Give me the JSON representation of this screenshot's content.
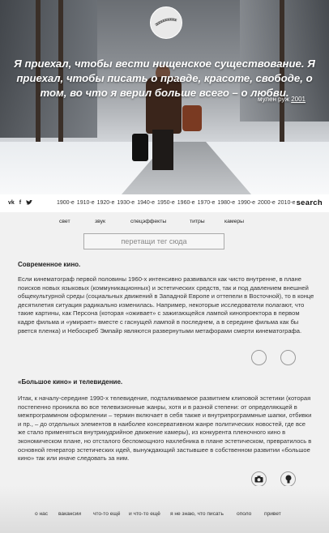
{
  "hero": {
    "quote": "Я приехал, чтобы вести нищенское существование. Я приехал, чтобы писать о правде, красоте, свободе, о том, во что я верил больше всего – о любви.",
    "source_title": "мулен руж",
    "source_year": "2001"
  },
  "nav": {
    "social": [
      "vk",
      "f",
      "t"
    ],
    "decades": [
      "1900-е",
      "1910-е",
      "1920-е",
      "1930-е",
      "1940-е",
      "1950-е",
      "1960-е",
      "1970-е",
      "1980-е",
      "1990-е",
      "2000-е",
      "2010-е"
    ],
    "search_label": "search"
  },
  "tags": [
    "свет",
    "звук",
    "спецэффекты",
    "титры",
    "камеры"
  ],
  "dropzone": {
    "placeholder": "перетащи тег сюда"
  },
  "articles": [
    {
      "title": "Современное кино.",
      "body": "Если кинематограф первой половины 1960-х интенсивно развивался как чисто внутренне, в плане поисков новых языковых (коммуникационных) и эстетических средств, так и под давлением внешней общекультурной среды (социальных движений в Западной Европе и оттепели в Восточной), то в конце десятилетия ситуация радикально изменилась. Например, некоторые исследователи полагают, что такие картины, как Персона (которая «оживает» с зажигающейся лампой кинопроектора в первом кадре фильма и «умирает» вместе с гаснущей лампой в последнем, а в середине фильма как бы рвется пленка) и Небоскреб Эмпайр являются развернутыми метафорами смерти кинематографа."
    },
    {
      "title": "«Большое кино» и телевидение.",
      "body": "Итак, к началу-середине 1990-х телевидение, подталкиваемое развитием клиповой эстетики (которая постепенно проникла во все телевизионные жанры, хотя и в разной степени: от определяющей в межпрограммном оформлении – термин включает в себя также и внутрипрограммные шапки, отбивки и пр., – до отдельных элементов в наиболее консервативном жанре политических новостей, где все же стало применяться внутрикудрийное движение камеры), из конкурента пленочного кино в экономическом плане, но отсталого беспомощного нахлебника в плане эстетическом, превратилось в основной генератор эстетических идей, вынуждающий застывшее в собственном развитии «большое кино» так или иначе следовать за ним."
    }
  ],
  "footer": [
    "о нас",
    "вакансии",
    "что-то ещё",
    "и что-то ещё",
    "я не знаю, что писать",
    "ополо",
    "привет"
  ]
}
